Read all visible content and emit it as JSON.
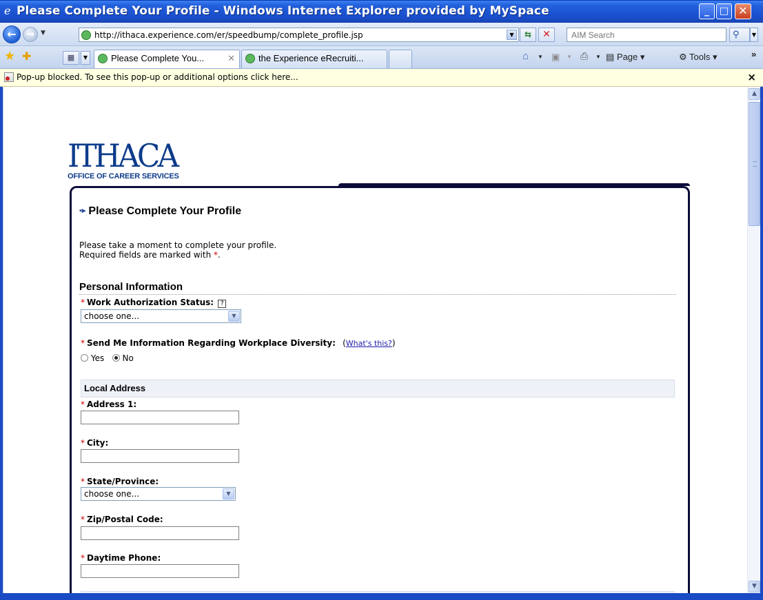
{
  "window": {
    "title": "Please Complete Your Profile - Windows Internet Explorer provided by MySpace",
    "minimize_glyph": "_",
    "maximize_glyph": "□",
    "close_glyph": "✕"
  },
  "address_bar": {
    "url": "http://ithaca.experience.com/er/speedbump/complete_profile.jsp",
    "search_placeholder": "AIM Search"
  },
  "tabs": [
    {
      "label": "Please Complete You...",
      "active": true
    },
    {
      "label": "the Experience eRecruiti...",
      "active": false
    }
  ],
  "command_bar": {
    "page_label": "Page ▾",
    "tools_label": "Tools ▾",
    "more_glyph": "»"
  },
  "info_bar": {
    "message": "Pop-up blocked. To see this pop-up or additional options click here...",
    "close_glyph": "×"
  },
  "logo": {
    "name": "ITHACA",
    "subtitle": "OFFICE OF CAREER SERVICES"
  },
  "page": {
    "heading": "Please Complete Your Profile",
    "intro_line1": "Please take a moment to complete your profile.",
    "intro_line2_prefix": "Required fields are marked with",
    "required_marker": "*",
    "intro_line2_suffix": "."
  },
  "personal_information": {
    "title": "Personal Information",
    "work_authorization": {
      "label": "Work Authorization Status:",
      "help_glyph": "?",
      "selected": "choose one..."
    },
    "diversity": {
      "label": "Send Me Information Regarding Workplace Diversity:",
      "link_open": "(",
      "link_text": "What's this?",
      "link_close": ")",
      "options": [
        "Yes",
        "No"
      ],
      "selected": "No"
    }
  },
  "local_address": {
    "title": "Local Address",
    "address1_label": "Address 1:",
    "city_label": "City:",
    "state_label": "State/Province:",
    "state_selected": "choose one...",
    "zip_label": "Zip/Postal Code:",
    "phone_label": "Daytime Phone:"
  },
  "colors": {
    "title_bar": "#1a4bc4",
    "logo_blue": "#0d3b8a",
    "required_red": "#cc0000",
    "panel_border": "#0c0c3a",
    "info_bar_bg": "#ffffe1"
  }
}
